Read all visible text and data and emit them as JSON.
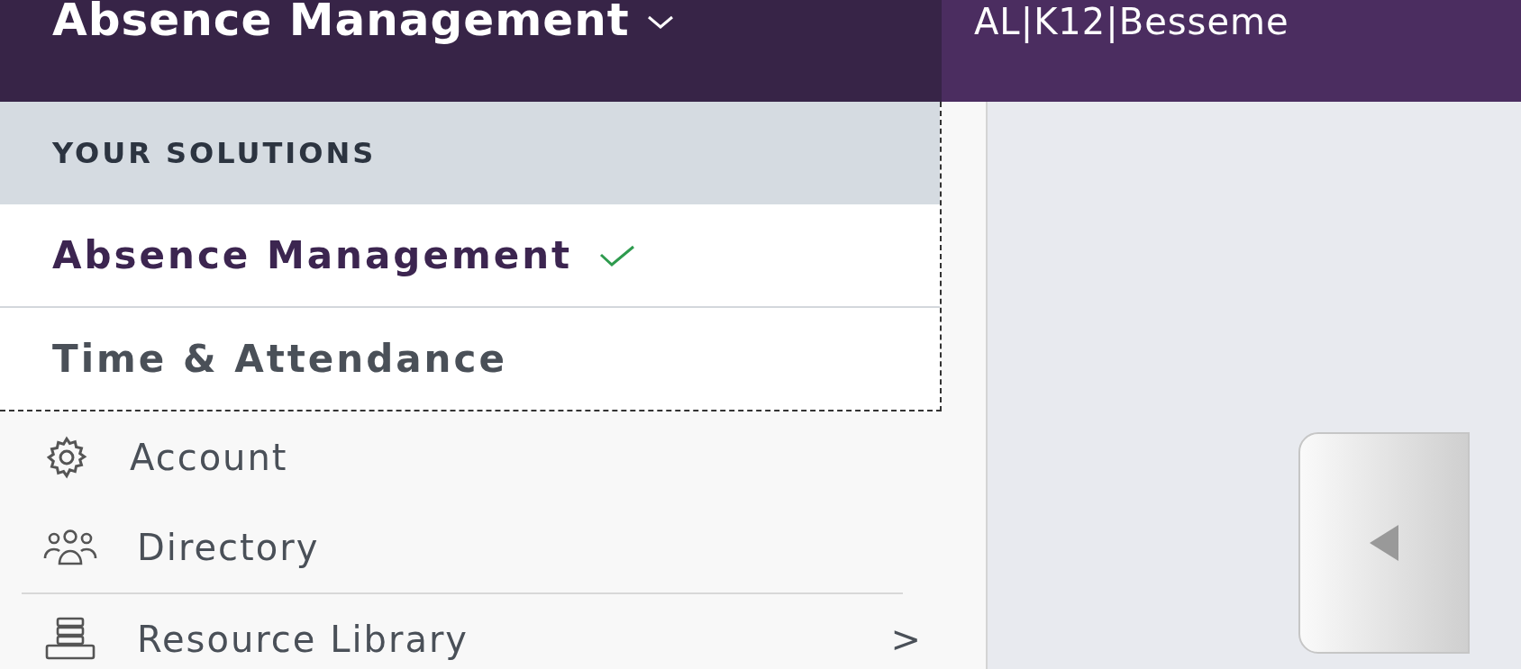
{
  "header": {
    "title": "Absence Management",
    "context": "AL|K12|Besseme"
  },
  "solutions_menu": {
    "heading": "YOUR SOLUTIONS",
    "items": [
      {
        "label": "Absence Management",
        "selected": true
      },
      {
        "label": "Time & Attendance",
        "selected": false
      }
    ]
  },
  "sidebar": {
    "items": [
      {
        "label": "Account"
      },
      {
        "label": "Directory"
      },
      {
        "label": "Resource Library",
        "arrow": ">"
      }
    ]
  }
}
